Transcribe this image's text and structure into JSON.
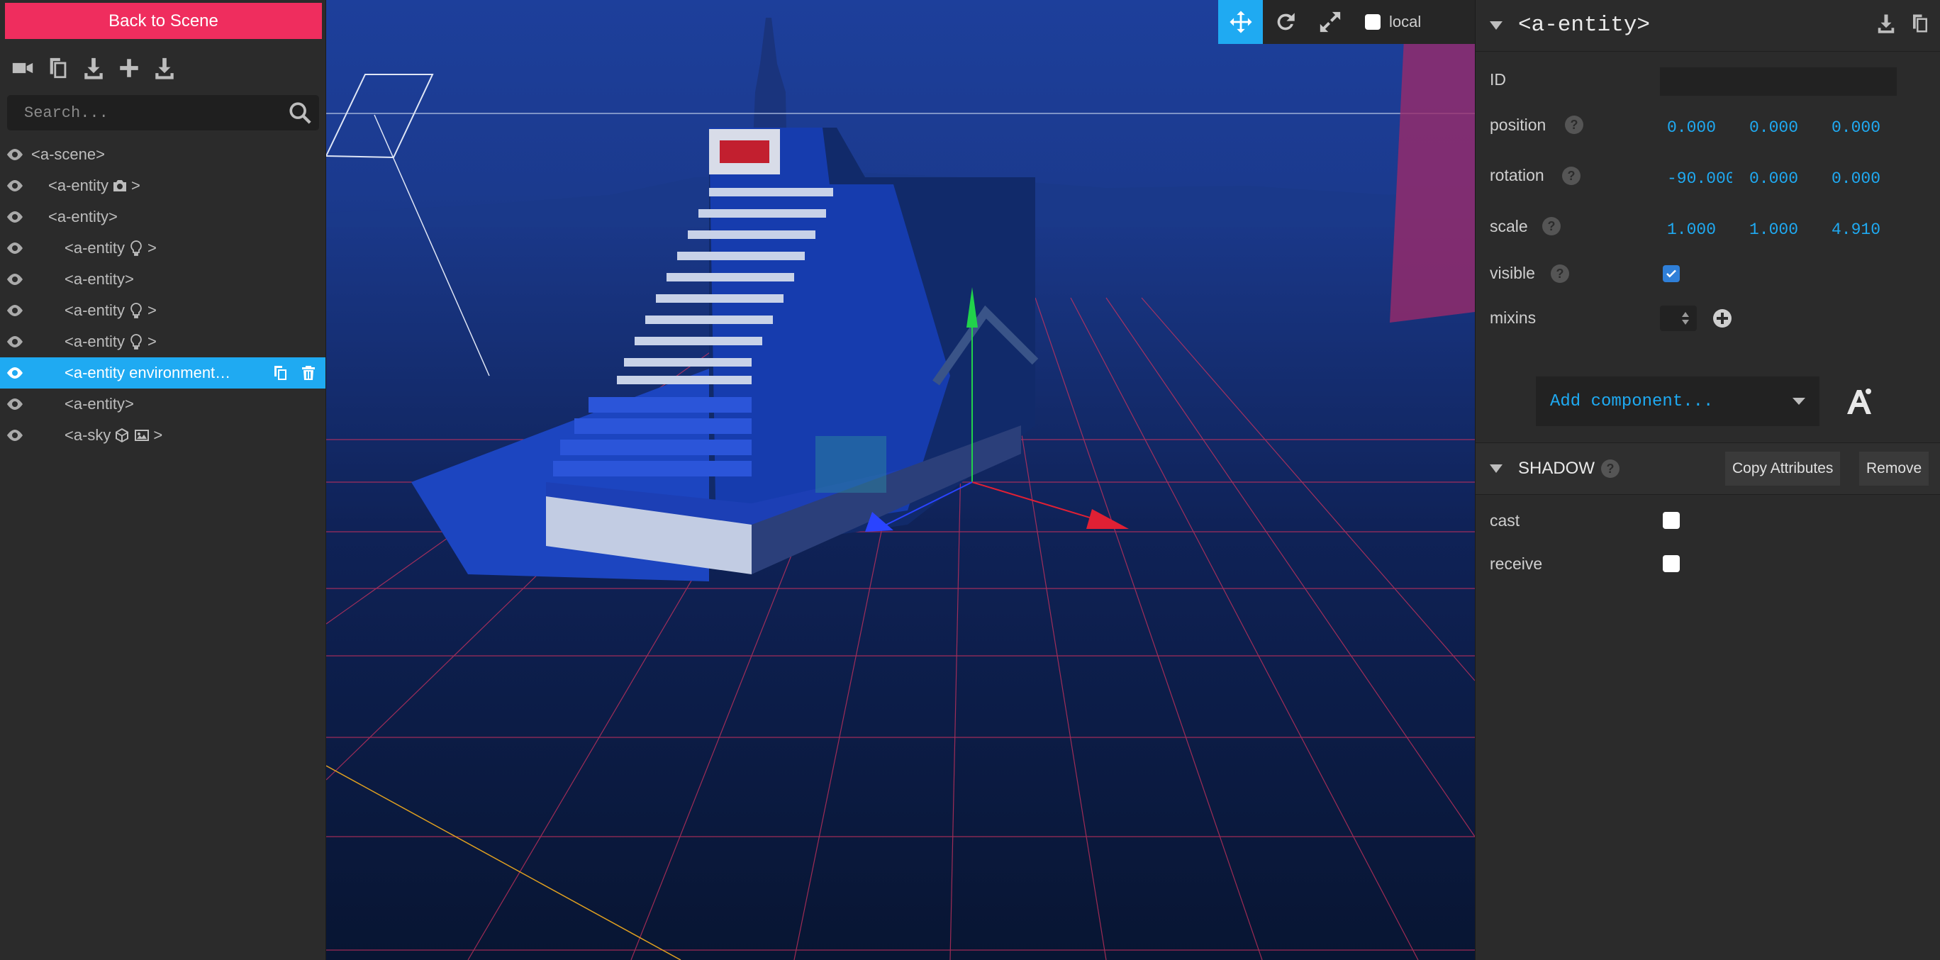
{
  "left_panel": {
    "back_label": "Back to Scene",
    "search_placeholder": "Search...",
    "toolbar_icons": [
      "camera-icon",
      "copy-icon",
      "download-icon",
      "plus-icon",
      "export-icon"
    ],
    "tree": [
      {
        "label": "<a-scene>",
        "extra": ""
      },
      {
        "label": "<a-entity",
        "extra": "camera",
        "close": ">"
      },
      {
        "label": "<a-entity>",
        "extra": ""
      },
      {
        "label": "<a-entity",
        "extra": "light",
        "close": ">"
      },
      {
        "label": "<a-entity>",
        "extra": ""
      },
      {
        "label": "<a-entity",
        "extra": "light",
        "close": ">"
      },
      {
        "label": "<a-entity",
        "extra": "light",
        "close": ">"
      },
      {
        "label": "<a-entity environment…",
        "extra": "",
        "selected": true
      },
      {
        "label": "<a-entity>",
        "extra": ""
      },
      {
        "label": "<a-sky",
        "extra": "cube,image",
        "close": ">"
      }
    ]
  },
  "viewport": {
    "tools": [
      "translate-icon",
      "rotate-icon",
      "scale-icon"
    ],
    "local_label": "local",
    "local_checked": false
  },
  "inspector": {
    "title": "<a-entity>",
    "id_label": "ID",
    "id_value": "",
    "position_label": "position",
    "position": [
      "0.000",
      "0.000",
      "0.000"
    ],
    "rotation_label": "rotation",
    "rotation": [
      "-90.000",
      "0.000",
      "0.000"
    ],
    "scale_label": "scale",
    "scale": [
      "1.000",
      "1.000",
      "4.910"
    ],
    "visible_label": "visible",
    "visible_checked": true,
    "mixins_label": "mixins",
    "add_component_label": "Add component...",
    "shadow": {
      "title": "SHADOW",
      "copy_label": "Copy Attributes",
      "remove_label": "Remove",
      "cast_label": "cast",
      "receive_label": "receive"
    }
  },
  "colors": {
    "accent": "#1faaf2",
    "back_button": "#ef2d5e",
    "panel": "#2b2b2b"
  }
}
